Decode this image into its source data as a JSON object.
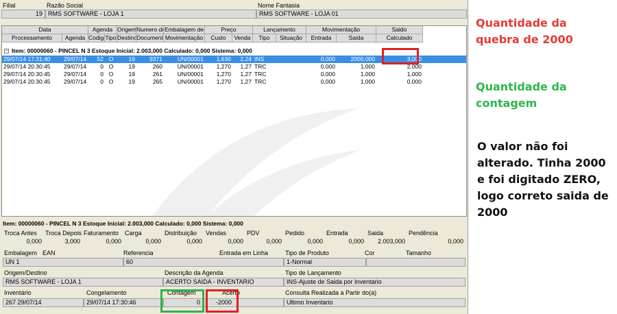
{
  "header": {
    "filial_label": "Filial",
    "razao_label": "Razão Social",
    "fantasia_label": "Nome Fantasia",
    "filial_value": "19",
    "razao_value": "RMS SOFTWARE - LOJA 1",
    "fantasia_value": "RMS SOFTWARE - LOJA 01"
  },
  "grid": {
    "group_headers": [
      "Data",
      "Agenda",
      "Origem/",
      "Numero do",
      "Embalagem de",
      "Preço",
      "Lançamento",
      "Movimentação",
      "Saldo"
    ],
    "columns": [
      "Processamento",
      "Agenda",
      "Codigo",
      "Tipo",
      "Destino",
      "Documento",
      "Movimentação",
      "Custo",
      "Venda",
      "Tipo",
      "Situação",
      "Entrada",
      "Saida",
      "Calculado"
    ],
    "tree_label": "Item: 00000060 - PINCEL N 3  Estoque Inicial: 2.003,000  Calculado: 0,000  Sistema: 0,000",
    "tree_toggle": "−",
    "rows": [
      [
        "29/07/14 17:31:40",
        "29/07/14",
        "52",
        "O",
        "19",
        "9371",
        "UN/00001",
        "1,630",
        "2,24",
        "INS",
        "",
        "0,000",
        "2000,000",
        "3,000"
      ],
      [
        "29/07/14 20:30:45",
        "29/07/14",
        "0",
        "O",
        "19",
        "260",
        "UN/00001",
        "1,270",
        "1,27",
        "TRC",
        "",
        "0,000",
        "1,000",
        "2,000"
      ],
      [
        "29/07/14 20:30:45",
        "29/07/14",
        "0",
        "O",
        "19",
        "261",
        "UN/00001",
        "1,270",
        "1,27",
        "TRC",
        "",
        "0,000",
        "1,000",
        "1,000"
      ],
      [
        "29/07/14 20:30:45",
        "29/07/14",
        "0",
        "O",
        "19",
        "265",
        "UN/00001",
        "1,270",
        "1,27",
        "TRC",
        "",
        "0,000",
        "1,000",
        "0,000"
      ]
    ]
  },
  "bottom": {
    "summary": "Item: 00000060 - PINCEL N 3  Estoque Inicial: 2.003,000  Calculado: 0,000  Sistema: 0,000",
    "stats_labels": [
      "Troca Antes",
      "Troca Depois",
      "Faturamento",
      "Carga",
      "Distribuição",
      "Vendas",
      "PDV",
      "Pedido",
      "Entrada",
      "Saida",
      "Pendência"
    ],
    "stats_values": [
      "0,000",
      "3,000",
      "0,000",
      "0,000",
      "0,000",
      "0,000",
      "0,000",
      "0,000",
      "0,000",
      "2.003,000",
      "0,000"
    ],
    "embalagem_label": "Embalagem",
    "ean_label": "EAN",
    "referencia_label": "Referencia",
    "entrada_linha_label": "Entrada em Linha",
    "tipo_produto_label": "Tipo de Produto",
    "cor_label": "Cor",
    "tamanho_label": "Tamanho",
    "embalagem_value": "UN   1",
    "referencia_value": "60",
    "tipo_produto_value": "1-Normal",
    "origem_label": "Origem/Destino",
    "descricao_label": "Descrição da Agenda",
    "tipo_lanc_label": "Tipo de Lançamento",
    "origem_value": "RMS SOFTWARE - LOJA 1",
    "descricao_value": "ACERTO SAIDA - INVENTARIO",
    "tipo_lanc_value": "INS-Ajuste de Saida por Inventario",
    "inventario_label": "Inventário",
    "congelamento_label": "Congelamento",
    "contagem_label": "Contagem",
    "acerto_label": "Acerto",
    "consulta_label": "Consulta Realizada a Partir do(a)",
    "inventario_value": "267 29/07/14",
    "congelamento_value": "29/07/14 17:30:46",
    "contagem_value": "0",
    "acerto_value": "-2000",
    "consulta_value": "Ultimo Inventario"
  },
  "annotations": {
    "red_note": [
      "Quantidade da",
      "quebra de 2000"
    ],
    "green_note": [
      "Quantidade da",
      "contagem"
    ],
    "black_note": [
      "O valor não foi",
      "alterado. Tinha 2000",
      "e foi digitado ZERO,",
      "logo correto saida de",
      "2000"
    ],
    "red_color": "#e53935",
    "green_color": "#2db54a",
    "black_color": "#111111"
  }
}
